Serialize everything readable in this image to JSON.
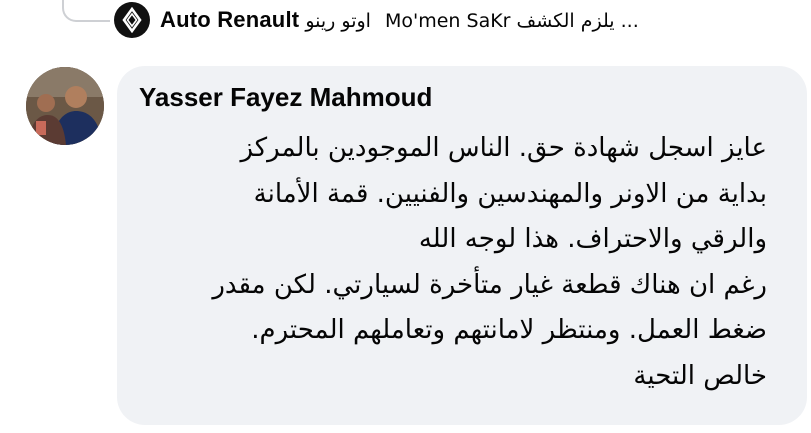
{
  "reply_preview": {
    "page_name": "Auto Renault",
    "page_name_ar": "اوتو رينو",
    "replied_to": "Mo'men SaKr",
    "snippet": "يلزم الكشف ..."
  },
  "comment": {
    "author": "Yasser Fayez Mahmoud",
    "lines": [
      "عايز اسجل شهادة حق. الناس الموجودين بالمركز",
      "بداية من الاونر والمهندسين والفنيين. قمة الأمانة",
      "والرقي والاحتراف. هذا لوجه الله",
      "رغم ان هناك قطعة غيار متأخرة لسيارتي. لكن مقدر",
      "ضغط العمل. ومنتظر لامانتهم وتعاملهم المحترم.",
      "خالص التحية"
    ]
  },
  "colors": {
    "bubble_background": "#f0f2f5",
    "text": "#050505",
    "connector": "#ced0d4"
  }
}
